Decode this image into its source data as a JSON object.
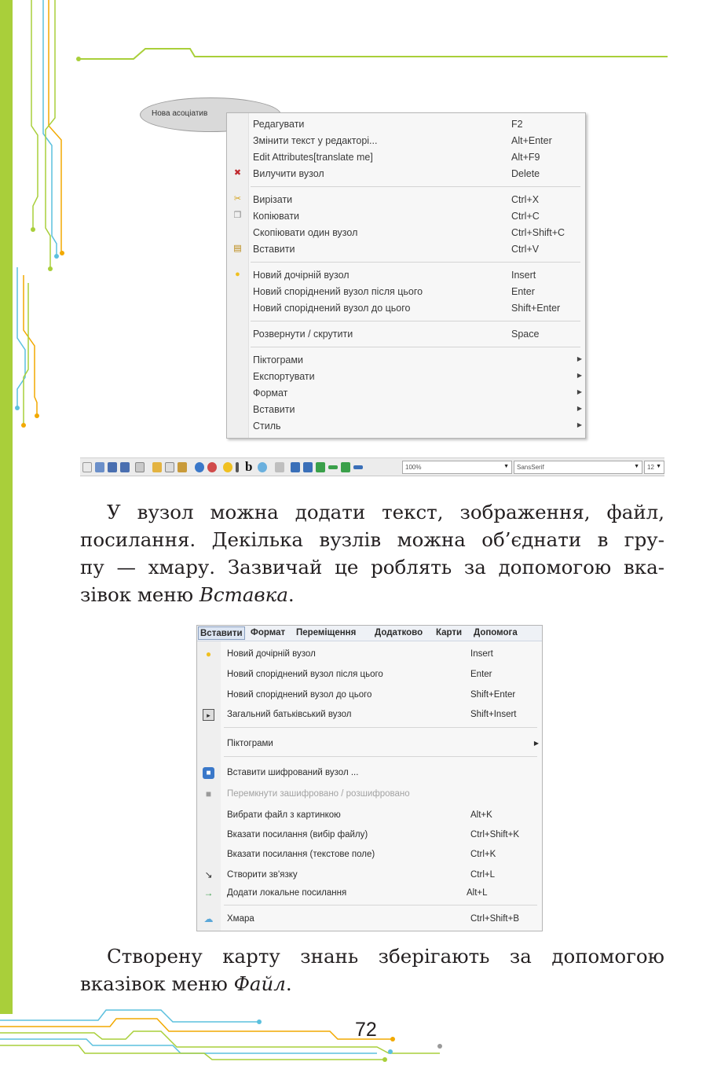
{
  "context_menu": {
    "node_label": "Нова асоціатив",
    "items": [
      {
        "label": "Редагувати",
        "shortcut": "F2",
        "icon": ""
      },
      {
        "label": "Змінити текст у редакторі...",
        "shortcut": "Alt+Enter",
        "icon": ""
      },
      {
        "label": "Edit Attributes[translate me]",
        "shortcut": "Alt+F9",
        "icon": ""
      },
      {
        "label": "Вилучити вузол",
        "shortcut": "Delete",
        "icon": "delete-icon"
      },
      {
        "label": "Вирізати",
        "shortcut": "Ctrl+X",
        "icon": "cut-icon"
      },
      {
        "label": "Копіювати",
        "shortcut": "Ctrl+C",
        "icon": "copy-icon"
      },
      {
        "label": "Скопіювати один вузол",
        "shortcut": "Ctrl+Shift+C",
        "icon": ""
      },
      {
        "label": "Вставити",
        "shortcut": "Ctrl+V",
        "icon": "paste-icon"
      },
      {
        "label": "Новий дочірній вузол",
        "shortcut": "Insert",
        "icon": "lightbulb-icon"
      },
      {
        "label": "Новий споріднений вузол після цього",
        "shortcut": "Enter",
        "icon": ""
      },
      {
        "label": "Новий споріднений вузол до цього",
        "shortcut": "Shift+Enter",
        "icon": ""
      },
      {
        "label": "Розвернути / скрутити",
        "shortcut": "Space",
        "icon": ""
      },
      {
        "label": "Піктограми",
        "shortcut": "",
        "submenu": true
      },
      {
        "label": "Експортувати",
        "shortcut": "",
        "submenu": true
      },
      {
        "label": "Формат",
        "shortcut": "",
        "submenu": true
      },
      {
        "label": "Вставити",
        "shortcut": "",
        "submenu": true
      },
      {
        "label": "Стиль",
        "shortcut": "",
        "submenu": true
      }
    ]
  },
  "toolbar": {
    "bold_label": "b",
    "zoom_value": "100%",
    "font_value": "SansSerif",
    "size_value": "12"
  },
  "paragraph1": {
    "line1": "У вузол можна додати текст, зображення, файл,",
    "line2": "посилання. Декілька вузлів можна об’єднати в гру-",
    "line3": "пу — хмару. Зазвичай це роблять за допомогою вка-",
    "line4_prefix": "зівок меню ",
    "line4_em": "Вставка",
    "line4_suffix": "."
  },
  "insert_menu": {
    "menubar": [
      "Вставити",
      "Формат",
      "Переміщення",
      "Додатково",
      "Карти",
      "Допомога"
    ],
    "items": [
      {
        "label": "Новий дочірній вузол",
        "shortcut": "Insert",
        "icon": "lightbulb-icon"
      },
      {
        "label": "Новий споріднений вузол після цього",
        "shortcut": "Enter",
        "icon": ""
      },
      {
        "label": "Новий споріднений вузол до цього",
        "shortcut": "Shift+Enter",
        "icon": ""
      },
      {
        "label": "Загальний батьківський вузол",
        "shortcut": "Shift+Insert",
        "icon": "parent-node-icon"
      },
      {
        "label": "Піктограми",
        "shortcut": "",
        "submenu": true
      },
      {
        "label": "Вставити шифрований вузол ...",
        "shortcut": "",
        "icon": "lock-icon"
      },
      {
        "label": "Перемкнути зашифровано / розшифровано",
        "shortcut": "",
        "icon": "unlock-icon",
        "disabled": true
      },
      {
        "label": "Вибрати файл з картинкою",
        "shortcut": "Alt+K",
        "icon": ""
      },
      {
        "label": "Вказати посилання (вибір файлу)",
        "shortcut": "Ctrl+Shift+K",
        "icon": ""
      },
      {
        "label": "Вказати посилання (текстове поле)",
        "shortcut": "Ctrl+K",
        "icon": ""
      },
      {
        "label": "Створити зв'язку",
        "shortcut": "Ctrl+L",
        "icon": "connector-icon"
      },
      {
        "label": "Додати локальне посилання",
        "shortcut": "Alt+L",
        "icon": "arrow-link-icon"
      },
      {
        "label": "Хмара",
        "shortcut": "Ctrl+Shift+B",
        "icon": "cloud-icon"
      }
    ]
  },
  "paragraph2": {
    "line1": "Створену карту знань зберігають за допомогою",
    "line2_prefix": "вказівок меню ",
    "line2_em": "Файл",
    "line2_suffix": "."
  },
  "page_number": "72",
  "colors": {
    "accent_green": "#a9cf3a",
    "accent_blue": "#5bc0de",
    "accent_orange": "#f2a900",
    "text": "#231f20"
  }
}
